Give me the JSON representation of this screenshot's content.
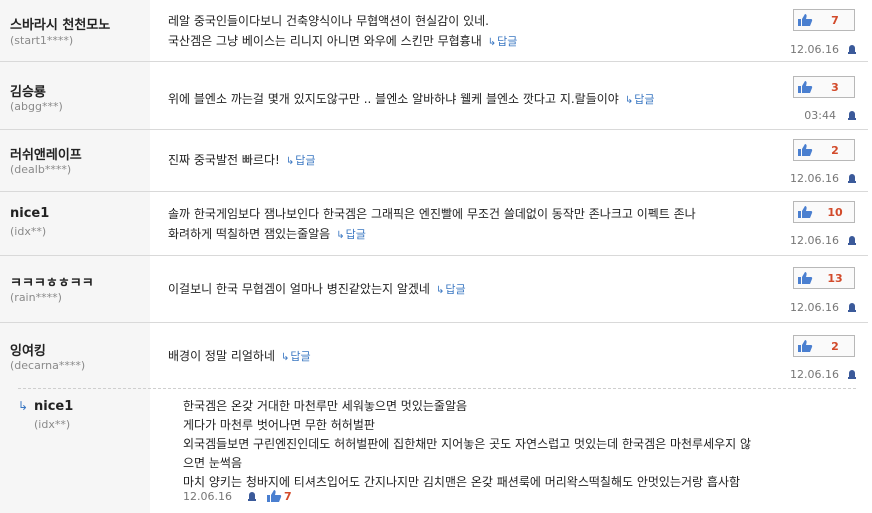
{
  "comments": [
    {
      "nickname": "스바라시 천천모노",
      "user_id": "(start1****)",
      "lines": [
        "레알 중국인들이다보니 건축양식이나 무협액션이 현실감이 있네.",
        "국산겜은 그냥 베이스는 리니지 아니면 와우에 스킨만 무협흉내"
      ],
      "reply_label": "답글",
      "votes": "7",
      "date": "12.06.16"
    },
    {
      "nickname": "김승룡",
      "user_id": "(abgg***)",
      "lines": [
        "위에 블엔소 까는걸 몇개 있지도않구만 .. 블엔소 알바하냐 웰케 블엔소 깟다고 지.랄들이야"
      ],
      "reply_label": "답글",
      "votes": "3",
      "date": "03:44"
    },
    {
      "nickname": "러쉬앤레이프",
      "user_id": "(dealb****)",
      "lines": [
        "진짜 중국발전 빠르다!"
      ],
      "reply_label": "답글",
      "votes": "2",
      "date": "12.06.16"
    },
    {
      "nickname": "nice1",
      "user_id": "(idx**)",
      "lines": [
        "솔까 한국게임보다 잼나보인다 한국겜은 그래픽은 엔진빨에 무조건 쓸데없이 동작만 존나크고 이펙트 존나",
        "화려하게 떡칠하면 잼있는줄알음"
      ],
      "reply_label": "답글",
      "votes": "10",
      "date": "12.06.16"
    },
    {
      "nickname": "ㅋㅋㅋㅎㅎㅋㅋ",
      "user_id": "(rain****)",
      "lines": [
        "이걸보니 한국 무협겜이 얼마나 병진같았는지 알겠네"
      ],
      "reply_label": "답글",
      "votes": "13",
      "date": "12.06.16"
    },
    {
      "nickname": "잉여킹",
      "user_id": "(decarna****)",
      "lines": [
        "배경이 정말 리얼하네"
      ],
      "reply_label": "답글",
      "votes": "2",
      "date": "12.06.16"
    }
  ],
  "reply": {
    "nickname": "nice1",
    "user_id": "(idx**)",
    "lines": [
      "한국겜은 온갖 거대한 마천루만 세워놓으면 멋있는줄알음",
      "게다가 마천루 벗어나면 무한 허허벌판",
      "외국겜들보면 구린엔진인데도 허허벌판에 집한채만 지어놓은 곳도 자연스럽고 멋있는데 한국겜은 마천루세우지 않",
      "으면 눈썩음",
      "마치 양키는 청바지에 티셔츠입어도 간지나지만 김치맨은 온갖 패션룩에 머리왁스떡칠해도 안멋있는거랑 흡사함"
    ],
    "date": "12.06.16",
    "votes": "7"
  },
  "colors": {
    "accent_link": "#3a77c2",
    "vote_count": "#d24a2a",
    "thumb": "#4a7fd0"
  },
  "icons": {
    "reply_arrow": "↳",
    "vote": "thumbs-up-icon",
    "report": "alarm-icon"
  }
}
